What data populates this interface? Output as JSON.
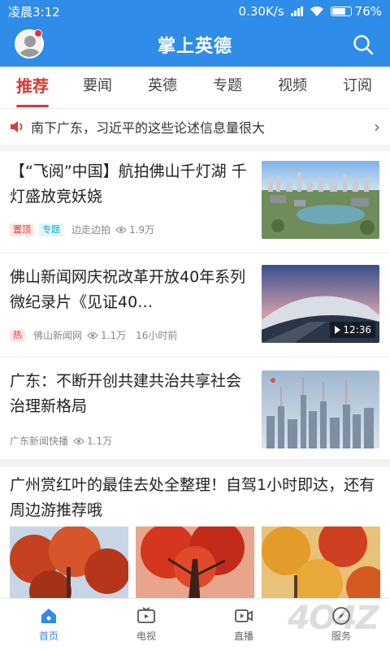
{
  "status": {
    "time": "凌晨3:12",
    "network_speed": "0.30K/s",
    "battery": "76%",
    "battery_level": 0.76
  },
  "appbar": {
    "title": "掌上英德"
  },
  "tabs": [
    {
      "label": "推荐",
      "active": true
    },
    {
      "label": "要闻"
    },
    {
      "label": "英德"
    },
    {
      "label": "专题"
    },
    {
      "label": "视频"
    },
    {
      "label": "订阅"
    }
  ],
  "marquee": {
    "text": "南下广东，习近平的这些论述信息量很大"
  },
  "news": [
    {
      "title": "【“飞阅”中国】航拍佛山千灯湖 千灯盛放竞妖娆",
      "badges": [
        "置顶",
        "专题"
      ],
      "source": "边走边拍",
      "views": "1.9万"
    },
    {
      "title": "佛山新闻网庆祝改革开放40年系列微纪录片《见证40…",
      "badges": [
        "热"
      ],
      "source": "佛山新闻网",
      "views": "1.1万",
      "time": "16小时前",
      "video_duration": "12:36"
    },
    {
      "title": "广东：不断开创共建共治共享社会治理新格局",
      "source": "广东新闻快播",
      "views": "1.1万"
    },
    {
      "title": "广州赏红叶的最佳去处全整理！自驾1小时即达，还有周边游推荐哦"
    }
  ],
  "bottom_nav": [
    {
      "label": "首页",
      "icon": "home-icon",
      "active": true
    },
    {
      "label": "电视",
      "icon": "tv-icon"
    },
    {
      "label": "直播",
      "icon": "live-icon"
    },
    {
      "label": "服务",
      "icon": "compass-icon"
    }
  ],
  "watermark": "4O4Z",
  "colors": {
    "primary": "#2f8ce8",
    "accent": "#d83a34"
  }
}
